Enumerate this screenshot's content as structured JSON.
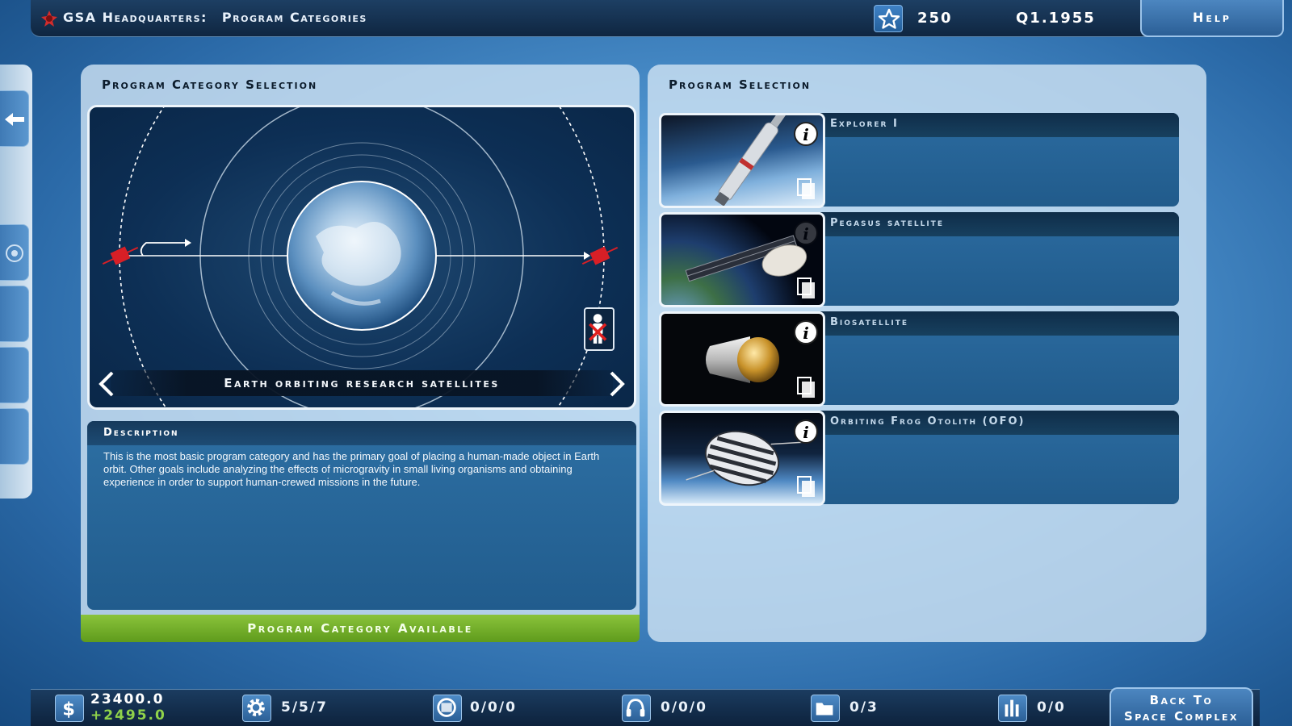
{
  "header": {
    "org": "GSA Headquarters:",
    "screen": "Program Categories",
    "star_points": "250",
    "quarter": "Q1.1955",
    "help_label": "Help"
  },
  "category_panel": {
    "title": "Program Category Selection",
    "category_name": "Earth orbiting research satellites",
    "description_header": "Description",
    "description": "This is the most basic program category and has the primary goal of placing a human-made object in Earth orbit. Other goals include analyzing the effects of microgravity in small living organisms and obtaining experience in order to support human-crewed missions in the future.",
    "status": "Program Category Available"
  },
  "program_panel": {
    "title": "Program Selection",
    "programs": [
      {
        "name": "Explorer I"
      },
      {
        "name": "Pegasus satellite"
      },
      {
        "name": "Biosatellite"
      },
      {
        "name": "Orbiting Frog Otolith (OFO)"
      }
    ]
  },
  "footer": {
    "money": "23400.0",
    "money_delta": "+2495.0",
    "engineers": "5/5/7",
    "facilities": "0/0/0",
    "astronauts": "0/0/0",
    "programs": "0/3",
    "launches": "0/0",
    "back_label_1": "Back To",
    "back_label_2": "Space Complex"
  },
  "colors": {
    "available_green": "#7ab32e",
    "panel_dark": "#0d2f55"
  },
  "icons": [
    "gsa-logo-icon",
    "star-icon",
    "back-arrow-icon",
    "target-icon",
    "info-icon",
    "copy-icon",
    "dollar-icon",
    "gear-icon",
    "facility-icon",
    "headset-icon",
    "folder-icon",
    "rocket-icon"
  ]
}
